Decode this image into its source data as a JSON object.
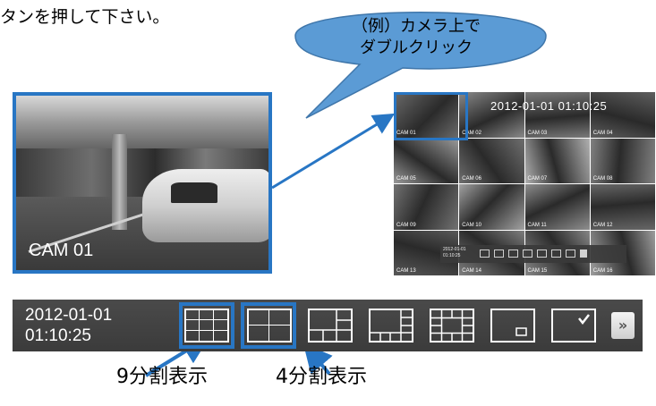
{
  "instruction_text": "タンを押して下さい。",
  "bubble_text": [
    "（例）カメラ上で",
    "ダブルクリック"
  ],
  "enlarged_camera": {
    "label": "CAM 01"
  },
  "camera_grid": {
    "timestamp_overlay": "2012-01-01 01:10:25",
    "cells": [
      {
        "label": "CAM 01",
        "selected": true
      },
      {
        "label": "CAM 02"
      },
      {
        "label": "CAM 03"
      },
      {
        "label": "CAM 04"
      },
      {
        "label": "CAM 05"
      },
      {
        "label": "CAM 06"
      },
      {
        "label": "CAM 07"
      },
      {
        "label": "CAM 08"
      },
      {
        "label": "CAM 09"
      },
      {
        "label": "CAM 10"
      },
      {
        "label": "CAM 11"
      },
      {
        "label": "CAM 12"
      },
      {
        "label": "CAM 13"
      },
      {
        "label": "CAM 14"
      },
      {
        "label": "CAM 15"
      },
      {
        "label": "CAM 16"
      }
    ],
    "mini_toolbar": {
      "date": "2012-01-01",
      "time": "01:10:25"
    }
  },
  "toolbar": {
    "date": "2012-01-01",
    "time": "01:10:25",
    "layout_buttons": [
      {
        "name": "9-split",
        "highlighted": true
      },
      {
        "name": "4-split",
        "highlighted": true
      },
      {
        "name": "6-split"
      },
      {
        "name": "8-split"
      },
      {
        "name": "13-split"
      },
      {
        "name": "pip"
      },
      {
        "name": "sequence"
      }
    ],
    "next_label": "»"
  },
  "captions": {
    "nine": "9分割表示",
    "four": "4分割表示"
  },
  "colors": {
    "highlight": "#2876c4",
    "bubble": "#5b9bd5",
    "toolbar": "#3e3e3e"
  }
}
